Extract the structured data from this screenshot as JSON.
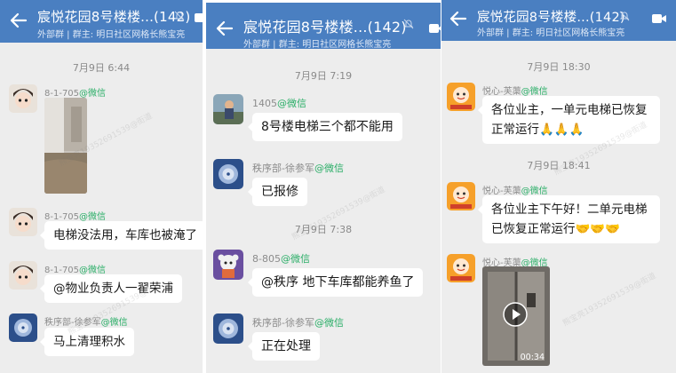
{
  "chat_title": "宸悦花园8号楼楼...(142)",
  "chat_subtitle": "外部群 | 群主: 明日社区网格长熊宝亮",
  "wechat_tag": "@微信",
  "watermark": "熊宝亮19352691539@街道",
  "panel_left": {
    "time_1": "7月9日 6:44",
    "sender_1": "8-1-705",
    "sender_2": "8-1-705",
    "msg_2": "电梯没法用，车库也被淹了",
    "sender_3": "8-1-705",
    "msg_3": "@物业负责人一翟荣浦",
    "sender_4": "秩序部-徐参军",
    "msg_4": "马上清理积水"
  },
  "panel_middle": {
    "time_1": "7月9日 7:19",
    "sender_1": "1405",
    "msg_1": "8号楼电梯三个都不能用",
    "sender_2": "秩序部-徐参军",
    "msg_2": "已报修",
    "time_2": "7月9日 7:38",
    "sender_3": "8-805",
    "msg_3": "@秩序 地下车库都能养鱼了",
    "sender_4": "秩序部-徐参军",
    "msg_4": "正在处理"
  },
  "panel_right": {
    "time_1": "7月9日 18:30",
    "sender_1": "悦心-芙蕖",
    "msg_1_line1": "各位业主，一单元电梯已恢复",
    "msg_1_line2": "正常运行🙏🙏🙏",
    "time_2": "7月9日 18:41",
    "sender_2": "悦心-芙蕖",
    "msg_2_line1": "各位业主下午好！二单元电梯",
    "msg_2_line2": "已恢复正常运行🤝🤝🤝",
    "sender_3": "悦心-芙蕖",
    "video_duration": "00:34"
  },
  "colors": {
    "header_blue": "#4a7fc1",
    "chat_bg": "#ededed",
    "tag_green": "#2aae67"
  }
}
